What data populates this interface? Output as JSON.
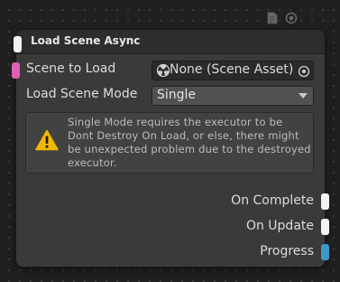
{
  "toolbar": {
    "icons": [
      "document-icon",
      "settings-icon"
    ]
  },
  "node": {
    "title": "Load Scene Async",
    "fields": {
      "scene_to_load": {
        "label": "Scene to Load",
        "value": "None (Scene Asset)",
        "icon": "scene-asset-icon"
      },
      "load_scene_mode": {
        "label": "Load Scene Mode",
        "selected": "Single"
      }
    },
    "help": {
      "type": "warning",
      "text": "Single Mode requires the executor to be Dont Destroy On Load, or else, there might be unexpected problem due to the destroyed executor."
    },
    "outputs": {
      "on_complete": "On Complete",
      "on_update": "On Update",
      "progress": "Progress"
    }
  },
  "colors": {
    "exec_port": "#f2f2f2",
    "scene_port": "#e05fb6",
    "float_port": "#3e98c8",
    "warning": "#f2b800"
  }
}
